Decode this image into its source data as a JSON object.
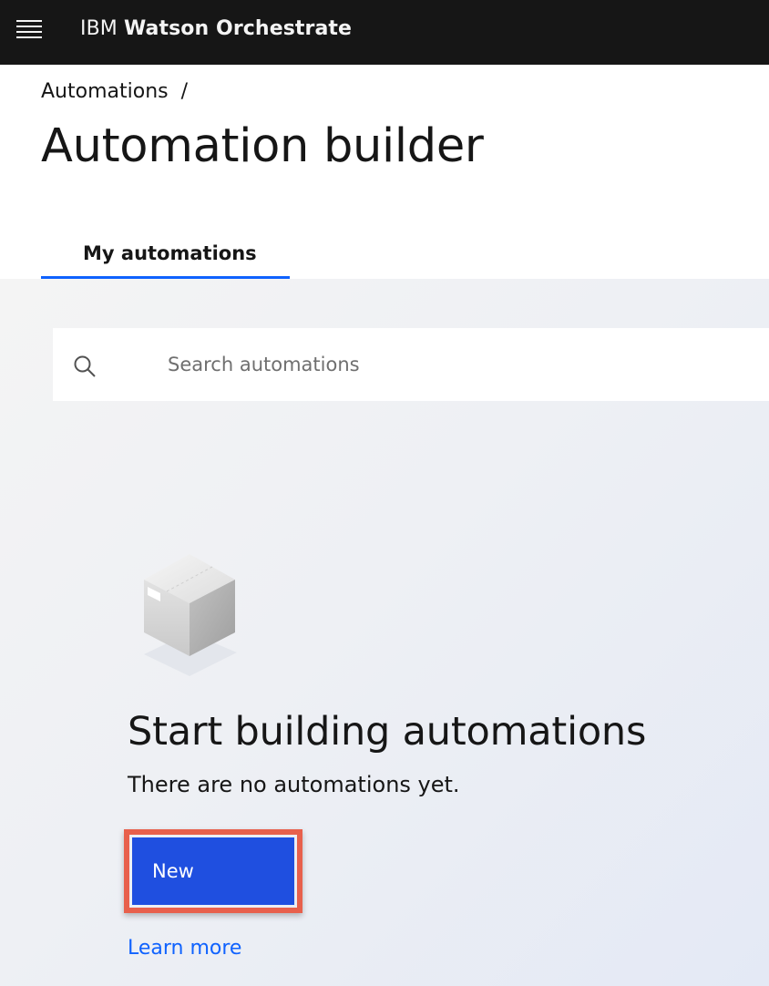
{
  "header": {
    "brand_prefix": "IBM",
    "brand_name": "Watson Orchestrate",
    "menu_icon": "hamburger-menu-icon"
  },
  "breadcrumb": {
    "items": [
      {
        "label": "Automations"
      }
    ],
    "separator": "/"
  },
  "page": {
    "title": "Automation builder"
  },
  "tabs": [
    {
      "label": "My automations",
      "selected": true
    }
  ],
  "search": {
    "placeholder": "Search automations",
    "value": "",
    "icon": "search-icon"
  },
  "empty_state": {
    "illustration": "box-icon",
    "title": "Start building automations",
    "description": "There are no automations yet.",
    "primary_action": "New",
    "link": "Learn more"
  },
  "colors": {
    "topbar": "#161616",
    "primary_button": "#1f4fe0",
    "highlight_outline": "#e8604c",
    "link": "#0f62fe",
    "tab_indicator": "#0f62fe"
  }
}
